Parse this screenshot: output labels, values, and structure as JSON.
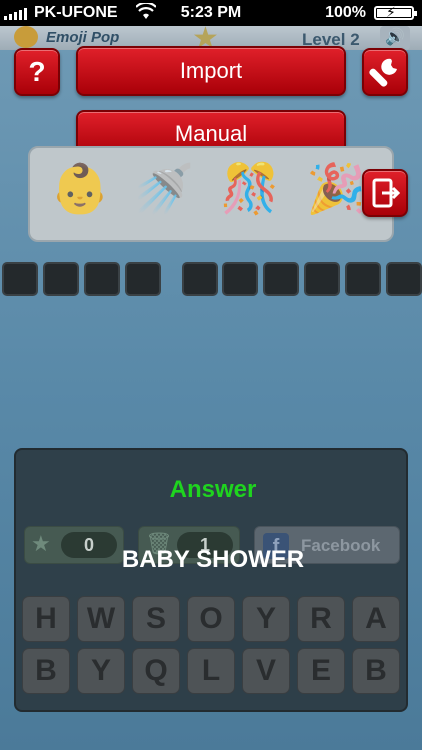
{
  "status_bar": {
    "carrier": "PK-UFONE",
    "time": "5:23 PM",
    "battery_percent": "100%",
    "battery_level": 1.0
  },
  "header": {
    "app_name": "Emoji Pop",
    "level": "Level 2"
  },
  "buttons": {
    "help": "?",
    "import": "Import",
    "manual": "Manual"
  },
  "puzzle": {
    "emojis": [
      "👶",
      "🚿",
      "🎊",
      "🎉"
    ],
    "word_slots": [
      4,
      6
    ]
  },
  "answer_overlay": {
    "title": "Answer",
    "answer": "BABY SHOWER",
    "hints": [
      {
        "icon": "star-icon",
        "count": "0"
      },
      {
        "icon": "trash-icon",
        "count": "1"
      }
    ],
    "facebook_label": "Facebook"
  },
  "keyboard": {
    "row1": [
      "H",
      "W",
      "S",
      "O",
      "Y",
      "R",
      "A"
    ],
    "row2": [
      "B",
      "Y",
      "Q",
      "L",
      "V",
      "E",
      "B"
    ]
  },
  "colors": {
    "accent_red": "#c8101a",
    "answer_green": "#1fd41f",
    "background_blue": "#5989a8"
  }
}
